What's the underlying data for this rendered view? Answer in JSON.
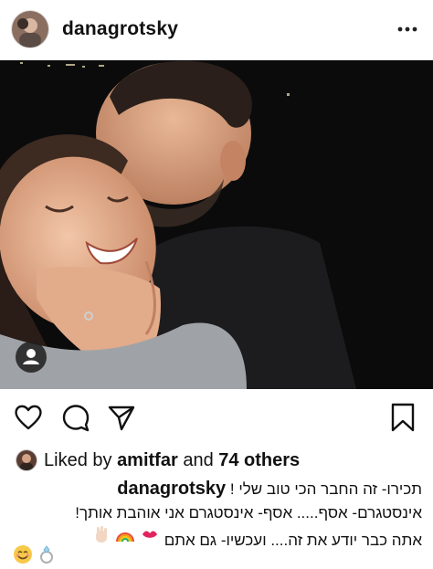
{
  "post": {
    "username": "danagrotsky"
  },
  "header": {
    "avatar_icon": "profile-avatar",
    "more_icon": "more-options-icon"
  },
  "photo": {
    "tag_icon": "user-tag-icon"
  },
  "actions": {
    "icons": [
      "heart-icon",
      "comment-icon",
      "share-icon",
      "bookmark-icon"
    ]
  },
  "likes": {
    "prefix": "Liked by ",
    "user": "amitfar",
    "middle": " and ",
    "others": "74 others"
  },
  "caption": {
    "username": "danagrotsky",
    "line1": "תכירו- זה החבר הכי טוב שלי ! ",
    "line2": "אינסטגרם- אסף..... אסף- אינסטגרם  אני אוהבת אותך!",
    "line3": "אתה כבר יודע את זה.... ועכשיו- גם אתם"
  },
  "emojis": [
    "kiss-mark",
    "rainbow",
    "raised-hand",
    "smiling-face",
    "ring"
  ],
  "colors": {
    "text": "#111111",
    "background": "#ffffff",
    "photo_bg": "#0b0b0c"
  }
}
